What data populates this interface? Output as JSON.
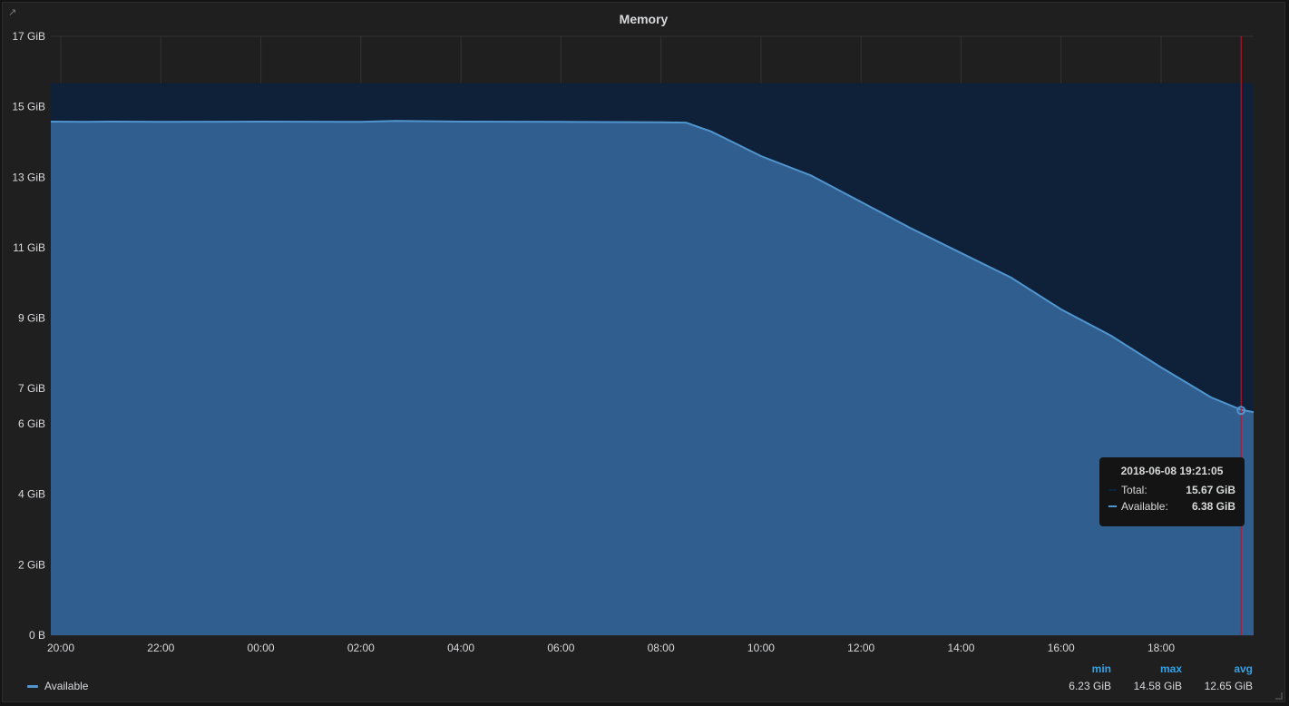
{
  "panel": {
    "title": "Memory"
  },
  "icons": {
    "link": "external-link-icon",
    "resize": "resize-handle-icon"
  },
  "colors": {
    "available": "#5195ce",
    "available_fill": "#2f5e8f",
    "total_fill": "#0f2138",
    "total_line": "#0c2340",
    "cursor": "#c4162a",
    "stat_header": "#33a2e5"
  },
  "chart_data": {
    "type": "area",
    "title": "Memory",
    "ylim": [
      0,
      17
    ],
    "y_unit": "GiB",
    "y_ticks": [
      {
        "value": 0,
        "label": "0 B"
      },
      {
        "value": 2,
        "label": "2 GiB"
      },
      {
        "value": 4,
        "label": "4 GiB"
      },
      {
        "value": 6,
        "label": "6 GiB"
      },
      {
        "value": 7,
        "label": "7 GiB"
      },
      {
        "value": 9,
        "label": "9 GiB"
      },
      {
        "value": 11,
        "label": "11 GiB"
      },
      {
        "value": 13,
        "label": "13 GiB"
      },
      {
        "value": 15,
        "label": "15 GiB"
      },
      {
        "value": 17,
        "label": "17 GiB"
      }
    ],
    "x_range_hours": [
      19.8,
      43.85
    ],
    "x_ticks": [
      {
        "hour": 20,
        "label": "20:00"
      },
      {
        "hour": 22,
        "label": "22:00"
      },
      {
        "hour": 24,
        "label": "00:00"
      },
      {
        "hour": 26,
        "label": "02:00"
      },
      {
        "hour": 28,
        "label": "04:00"
      },
      {
        "hour": 30,
        "label": "06:00"
      },
      {
        "hour": 32,
        "label": "08:00"
      },
      {
        "hour": 34,
        "label": "10:00"
      },
      {
        "hour": 36,
        "label": "12:00"
      },
      {
        "hour": 38,
        "label": "14:00"
      },
      {
        "hour": 40,
        "label": "16:00"
      },
      {
        "hour": 42,
        "label": "18:00"
      }
    ],
    "grid": true,
    "series": [
      {
        "name": "Total",
        "in_legend": false,
        "x_hours": [
          19.8,
          43.85
        ],
        "values": [
          15.67,
          15.67
        ]
      },
      {
        "name": "Available",
        "in_legend": true,
        "x_hours": [
          19.8,
          20.5,
          21,
          22,
          24,
          26,
          26.7,
          28,
          30,
          32,
          32.5,
          33,
          33.5,
          34,
          35,
          36,
          37,
          38,
          39,
          40,
          41,
          42,
          43,
          43.6,
          43.85
        ],
        "values": [
          14.58,
          14.57,
          14.58,
          14.57,
          14.58,
          14.57,
          14.6,
          14.58,
          14.57,
          14.56,
          14.55,
          14.3,
          13.95,
          13.6,
          13.05,
          12.3,
          11.55,
          10.85,
          10.15,
          9.25,
          8.5,
          7.6,
          6.75,
          6.4,
          6.33
        ],
        "min": "6.23 GiB",
        "max": "14.58 GiB",
        "avg": "12.65 GiB"
      }
    ],
    "cursor": {
      "hour": 43.6,
      "time": "2018-06-08 19:21:05",
      "total": "15.67 GiB",
      "available": "6.38 GiB",
      "available_value": 6.38
    },
    "legend": {
      "position": "bottom",
      "stat_headers": [
        "min",
        "max",
        "avg"
      ]
    }
  },
  "tooltip": {
    "time": "2018-06-08 19:21:05",
    "rows": [
      {
        "label": "Total:",
        "value": "15.67 GiB"
      },
      {
        "label": "Available:",
        "value": "6.38 GiB"
      }
    ]
  },
  "legend": {
    "series_name": "Available",
    "headers": {
      "min": "min",
      "max": "max",
      "avg": "avg"
    },
    "values": {
      "min": "6.23 GiB",
      "max": "14.58 GiB",
      "avg": "12.65 GiB"
    }
  }
}
